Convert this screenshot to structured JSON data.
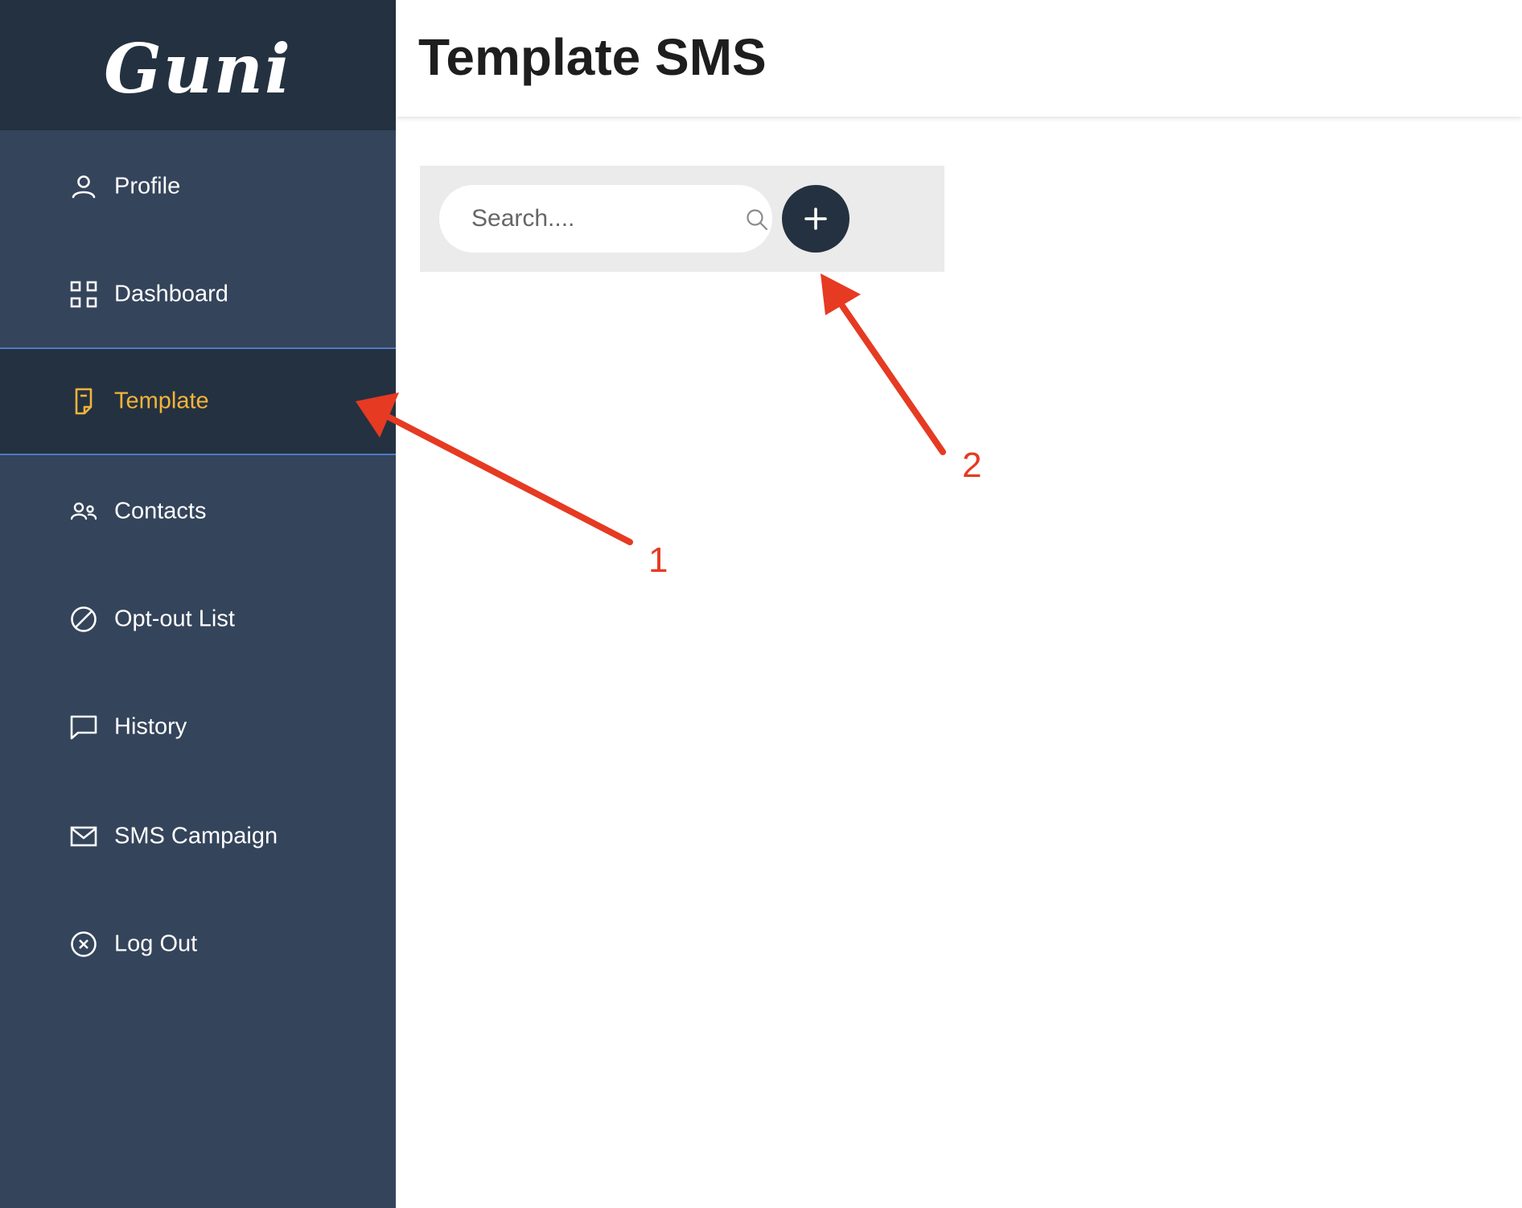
{
  "app": {
    "logo_text": "Guni"
  },
  "sidebar": {
    "items": [
      {
        "label": "Profile",
        "icon": "user-icon",
        "active": false
      },
      {
        "label": "Dashboard",
        "icon": "grid-icon",
        "active": false
      },
      {
        "label": "Template",
        "icon": "document-icon",
        "active": true
      },
      {
        "label": "Contacts",
        "icon": "users-icon",
        "active": false
      },
      {
        "label": "Opt-out List",
        "icon": "block-icon",
        "active": false
      },
      {
        "label": "History",
        "icon": "message-icon",
        "active": false
      },
      {
        "label": "SMS Campaign",
        "icon": "mail-icon",
        "active": false
      },
      {
        "label": "Log Out",
        "icon": "close-circle-icon",
        "active": false
      }
    ]
  },
  "header": {
    "title": "Template SMS"
  },
  "toolbar": {
    "search_placeholder": "Search....",
    "search_value": "",
    "add_icon": "plus-icon"
  },
  "annotations": {
    "labels": [
      "1",
      "2"
    ],
    "color": "#e63a22"
  },
  "colors": {
    "sidebar_bg": "#34445b",
    "sidebar_dark": "#243140",
    "active_label": "#f3b43a",
    "active_border": "#4f7ac4",
    "toolbar_bg": "#ebebeb"
  }
}
